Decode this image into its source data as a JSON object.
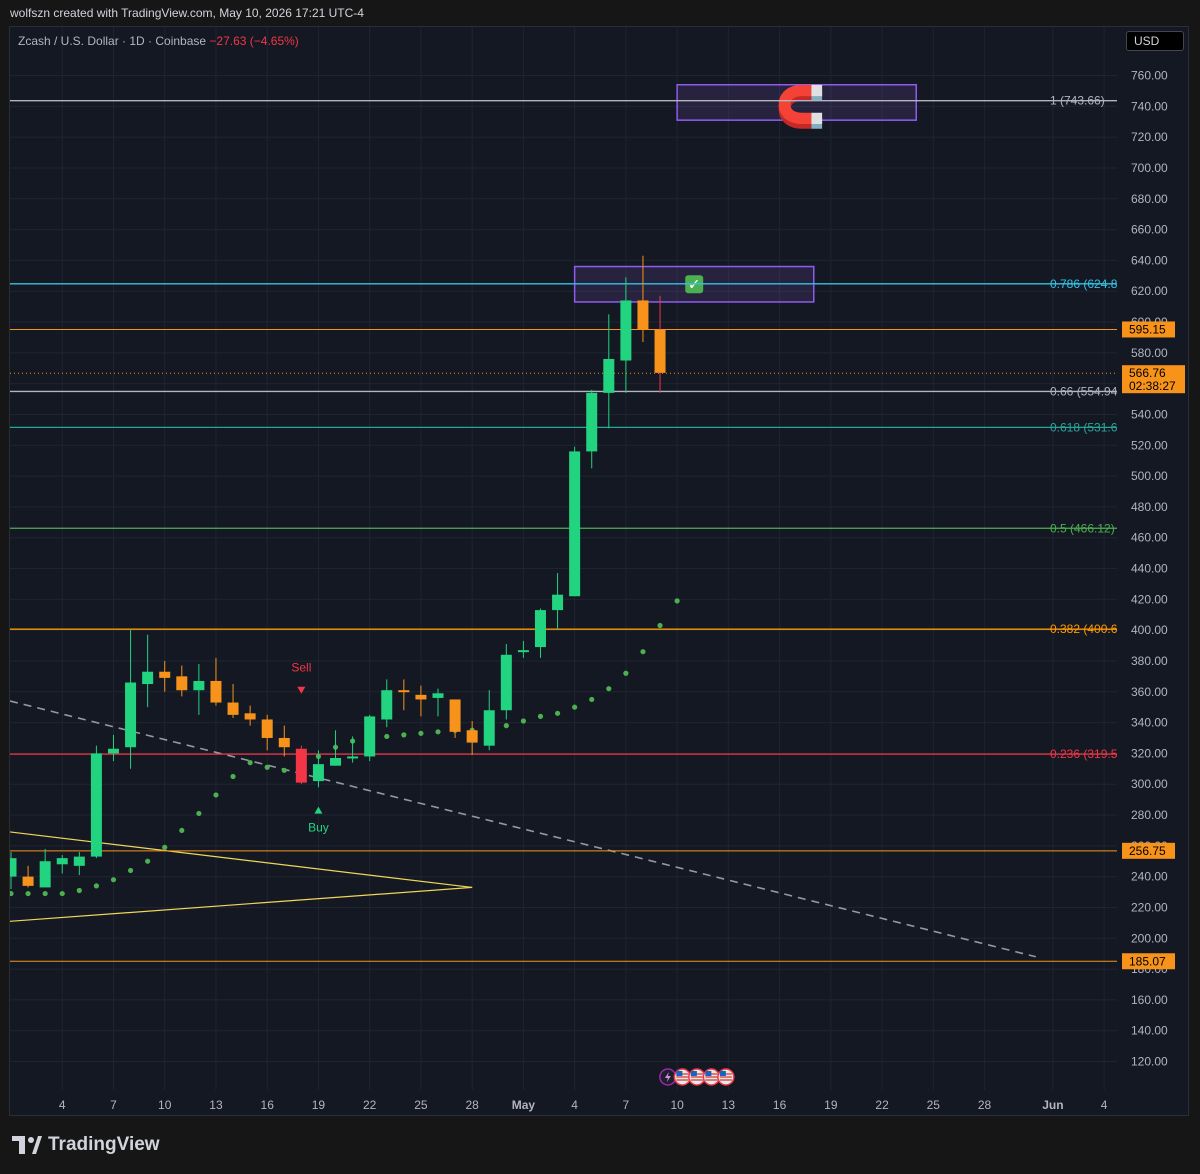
{
  "header": {
    "created_by": "wolfszn created with TradingView.com, May 10, 2026 17:21 UTC-4",
    "symbol": "Zcash / U.S. Dollar · 1D · Coinbase",
    "change": "−27.63 (−4.65%)",
    "currency_button": "USD"
  },
  "branding": {
    "logo_text": "TradingView"
  },
  "colors": {
    "up": "#22d37f",
    "down": "#f7931a",
    "sell_candle": "#f23645",
    "background": "#141823",
    "fib_1": "#b2b5be",
    "fib_0786": "#34c2e6",
    "fib_066": "#b2b5be",
    "fib_0618": "#26a69a",
    "fib_05": "#4caf50",
    "fib_0382": "#ff9800",
    "fib_0236": "#f23645",
    "hline": "#f7931a",
    "zone": "#7e57c2",
    "trend_dashed": "#9598a1",
    "triangle": "#f0d75a",
    "sar": "#4caf50"
  },
  "chart_data": {
    "type": "candlestick",
    "title": "Zcash / U.S. Dollar · 1D · Coinbase",
    "ylim": [
      110,
      772
    ],
    "y_ticks": [
      120,
      140,
      160,
      180,
      200,
      220,
      240,
      260,
      280,
      300,
      320,
      340,
      360,
      380,
      400,
      420,
      440,
      460,
      480,
      500,
      520,
      540,
      560,
      580,
      600,
      620,
      640,
      660,
      680,
      700,
      720,
      740,
      760
    ],
    "x_labels": [
      {
        "label": "4",
        "day": 4
      },
      {
        "label": "7",
        "day": 7
      },
      {
        "label": "10",
        "day": 10
      },
      {
        "label": "13",
        "day": 13
      },
      {
        "label": "16",
        "day": 16
      },
      {
        "label": "19",
        "day": 19
      },
      {
        "label": "22",
        "day": 22
      },
      {
        "label": "25",
        "day": 25
      },
      {
        "label": "28",
        "day": 28
      },
      {
        "label": "May",
        "day": 31
      },
      {
        "label": "4",
        "day": 34
      },
      {
        "label": "7",
        "day": 37
      },
      {
        "label": "10",
        "day": 40
      },
      {
        "label": "13",
        "day": 43
      },
      {
        "label": "16",
        "day": 46
      },
      {
        "label": "19",
        "day": 49
      },
      {
        "label": "22",
        "day": 52
      },
      {
        "label": "25",
        "day": 55
      },
      {
        "label": "28",
        "day": 58
      },
      {
        "label": "Jun",
        "day": 62
      },
      {
        "label": "4",
        "day": 65
      }
    ],
    "candles": [
      {
        "day": 1,
        "o": 240,
        "h": 256,
        "l": 232,
        "c": 252
      },
      {
        "day": 2,
        "o": 240,
        "h": 247,
        "l": 233,
        "c": 234
      },
      {
        "day": 3,
        "o": 233,
        "h": 258,
        "l": 233,
        "c": 250
      },
      {
        "day": 4,
        "o": 248,
        "h": 254,
        "l": 242,
        "c": 252
      },
      {
        "day": 5,
        "o": 247,
        "h": 256,
        "l": 241,
        "c": 253
      },
      {
        "day": 6,
        "o": 253,
        "h": 325,
        "l": 252,
        "c": 320
      },
      {
        "day": 7,
        "o": 320,
        "h": 332,
        "l": 315,
        "c": 323
      },
      {
        "day": 8,
        "o": 324,
        "h": 400,
        "l": 310,
        "c": 366
      },
      {
        "day": 9,
        "o": 365,
        "h": 397,
        "l": 350,
        "c": 373
      },
      {
        "day": 10,
        "o": 373,
        "h": 380,
        "l": 360,
        "c": 369
      },
      {
        "day": 11,
        "o": 370,
        "h": 377,
        "l": 357,
        "c": 361
      },
      {
        "day": 12,
        "o": 361,
        "h": 378,
        "l": 345,
        "c": 367
      },
      {
        "day": 13,
        "o": 367,
        "h": 382,
        "l": 351,
        "c": 353
      },
      {
        "day": 14,
        "o": 353,
        "h": 365,
        "l": 343,
        "c": 345
      },
      {
        "day": 15,
        "o": 346,
        "h": 351,
        "l": 338,
        "c": 342
      },
      {
        "day": 16,
        "o": 342,
        "h": 345,
        "l": 322,
        "c": 330
      },
      {
        "day": 17,
        "o": 330,
        "h": 338,
        "l": 318,
        "c": 324
      },
      {
        "day": 18,
        "o": 323,
        "h": 325,
        "l": 300,
        "c": 301
      },
      {
        "day": 19,
        "o": 302,
        "h": 322,
        "l": 298,
        "c": 313
      },
      {
        "day": 20,
        "o": 312,
        "h": 335,
        "l": 312,
        "c": 317
      },
      {
        "day": 21,
        "o": 317,
        "h": 331,
        "l": 314,
        "c": 318
      },
      {
        "day": 22,
        "o": 318,
        "h": 345,
        "l": 315,
        "c": 344
      },
      {
        "day": 23,
        "o": 342,
        "h": 368,
        "l": 337,
        "c": 361
      },
      {
        "day": 24,
        "o": 361,
        "h": 368,
        "l": 348,
        "c": 360
      },
      {
        "day": 25,
        "o": 358,
        "h": 364,
        "l": 344,
        "c": 355
      },
      {
        "day": 26,
        "o": 356,
        "h": 362,
        "l": 344,
        "c": 359
      },
      {
        "day": 27,
        "o": 355,
        "h": 355,
        "l": 330,
        "c": 334
      },
      {
        "day": 28,
        "o": 335,
        "h": 341,
        "l": 319,
        "c": 327
      },
      {
        "day": 29,
        "o": 325,
        "h": 361,
        "l": 322,
        "c": 348
      },
      {
        "day": 30,
        "o": 348,
        "h": 391,
        "l": 342,
        "c": 384
      },
      {
        "day": 31,
        "o": 386,
        "h": 393,
        "l": 382,
        "c": 387
      },
      {
        "day": 32,
        "o": 389,
        "h": 414,
        "l": 382,
        "c": 413
      },
      {
        "day": 33,
        "o": 413,
        "h": 437,
        "l": 400,
        "c": 423
      },
      {
        "day": 34,
        "o": 422,
        "h": 519,
        "l": 422,
        "c": 516
      },
      {
        "day": 35,
        "o": 516,
        "h": 556,
        "l": 505,
        "c": 554
      },
      {
        "day": 36,
        "o": 554,
        "h": 605,
        "l": 531,
        "c": 576
      },
      {
        "day": 37,
        "o": 575,
        "h": 629,
        "l": 554,
        "c": 614
      },
      {
        "day": 38,
        "o": 614,
        "h": 643,
        "l": 587,
        "c": 595
      },
      {
        "day": 39,
        "o": 595,
        "h": 617,
        "l": 554,
        "c": 567
      }
    ],
    "parabolic_sar": [
      {
        "day": 1,
        "v": 229
      },
      {
        "day": 2,
        "v": 229
      },
      {
        "day": 3,
        "v": 229
      },
      {
        "day": 4,
        "v": 229
      },
      {
        "day": 5,
        "v": 231
      },
      {
        "day": 6,
        "v": 234
      },
      {
        "day": 7,
        "v": 238
      },
      {
        "day": 8,
        "v": 244
      },
      {
        "day": 9,
        "v": 250
      },
      {
        "day": 10,
        "v": 259
      },
      {
        "day": 11,
        "v": 270
      },
      {
        "day": 12,
        "v": 281
      },
      {
        "day": 13,
        "v": 293
      },
      {
        "day": 14,
        "v": 305
      },
      {
        "day": 15,
        "v": 314
      },
      {
        "day": 16,
        "v": 311
      },
      {
        "day": 17,
        "v": 309
      },
      {
        "day": 18,
        "v": 310
      },
      {
        "day": 19,
        "v": 318
      },
      {
        "day": 20,
        "v": 324
      },
      {
        "day": 21,
        "v": 328
      },
      {
        "day": 22,
        "v": 330
      },
      {
        "day": 23,
        "v": 331
      },
      {
        "day": 24,
        "v": 332
      },
      {
        "day": 25,
        "v": 333
      },
      {
        "day": 26,
        "v": 334
      },
      {
        "day": 27,
        "v": 335
      },
      {
        "day": 28,
        "v": 335
      },
      {
        "day": 29,
        "v": 335
      },
      {
        "day": 30,
        "v": 338
      },
      {
        "day": 31,
        "v": 341
      },
      {
        "day": 32,
        "v": 344
      },
      {
        "day": 33,
        "v": 346
      },
      {
        "day": 34,
        "v": 350
      },
      {
        "day": 35,
        "v": 355
      },
      {
        "day": 36,
        "v": 362
      },
      {
        "day": 37,
        "v": 372
      },
      {
        "day": 38,
        "v": 386
      },
      {
        "day": 39,
        "v": 403
      },
      {
        "day": 40,
        "v": 419
      }
    ],
    "fib_levels": [
      {
        "ratio": "1",
        "value": 743.66,
        "label": "1 (743.66)",
        "colorKey": "fib_1"
      },
      {
        "ratio": "0.786",
        "value": 624.8,
        "label": "0.786 (624.8",
        "colorKey": "fib_0786"
      },
      {
        "ratio": "0.66",
        "value": 554.94,
        "label": "0.66 (554.94",
        "colorKey": "fib_066"
      },
      {
        "ratio": "0.618",
        "value": 531.6,
        "label": "0.618 (531.6",
        "colorKey": "fib_0618"
      },
      {
        "ratio": "0.5",
        "value": 466.12,
        "label": "0.5 (466.12)",
        "colorKey": "fib_05"
      },
      {
        "ratio": "0.382",
        "value": 400.6,
        "label": "0.382 (400.6",
        "colorKey": "fib_0382"
      },
      {
        "ratio": "0.236",
        "value": 319.5,
        "label": "0.236 (319.5",
        "colorKey": "fib_0236"
      }
    ],
    "horizontal_lines": [
      {
        "value": 595.15,
        "label": "595.15"
      },
      {
        "value": 256.75,
        "label": "256.75"
      },
      {
        "value": 185.07,
        "label": "185.07"
      }
    ],
    "last_price": {
      "value": 566.76,
      "label": "566.76",
      "countdown": "02:38:27"
    },
    "zones": [
      {
        "day_from": 40,
        "day_to": 54,
        "top": 754,
        "bottom": 731,
        "icon": "magnet-icon",
        "icon_glyph": "🧲"
      },
      {
        "day_from": 34,
        "day_to": 48,
        "top": 636,
        "bottom": 613,
        "icon": "check-icon",
        "icon_glyph": "✓"
      }
    ],
    "dashed_trendline": {
      "from": {
        "day": 0,
        "v": 354
      },
      "to": {
        "day": 61,
        "v": 188
      }
    },
    "triangle": {
      "upper_from": {
        "day": 0,
        "v": 269
      },
      "lower_from": {
        "day": 0,
        "v": 211
      },
      "apex": {
        "day": 28,
        "v": 233
      }
    },
    "signals": [
      {
        "type": "sell",
        "day": 18,
        "label": "Sell",
        "price": 373
      },
      {
        "type": "buy",
        "day": 19,
        "label": "Buy",
        "price": 290
      }
    ],
    "events": {
      "day": 40,
      "count": 4,
      "icons": [
        "lightning-icon",
        "us-flag-icon",
        "us-flag-icon",
        "us-flag-icon",
        "us-flag-icon"
      ]
    }
  }
}
